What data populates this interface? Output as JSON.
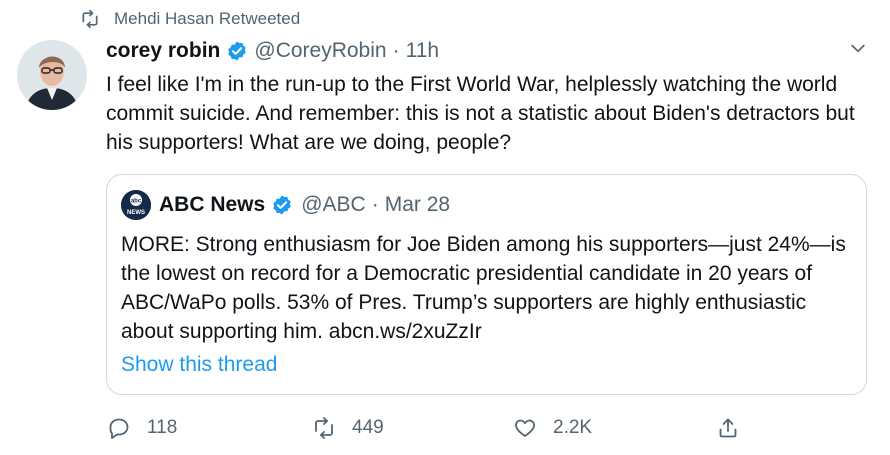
{
  "retweet": {
    "icon": "retweet-icon",
    "label": "Mehdi Hasan Retweeted"
  },
  "tweet": {
    "display_name": "corey robin",
    "handle": "@CoreyRobin",
    "separator": "·",
    "time": "11h",
    "text": "I feel like I'm in the run-up to the First World War, helplessly watching the world commit suicide. And remember: this is not a statistic about Biden's detractors but his supporters! What are we doing, people?"
  },
  "quote": {
    "logo_text": "abc NEWS",
    "display_name": "ABC News",
    "handle": "@ABC",
    "separator": "·",
    "time": "Mar 28",
    "text": "MORE: Strong enthusiasm for Joe Biden among his supporters—just 24%—is the lowest on record for a Democratic presidential candidate in 20 years of ABC/WaPo polls. 53% of Pres. Trump’s supporters are highly enthusiastic about supporting him. abcn.ws/2xuZzIr",
    "show_thread": "Show this thread"
  },
  "actions": {
    "reply_count": "118",
    "retweet_count": "449",
    "like_count": "2.2K"
  },
  "colors": {
    "accent": "#1d9bf0",
    "secondary_text": "#536471",
    "border": "#cfd9de"
  }
}
